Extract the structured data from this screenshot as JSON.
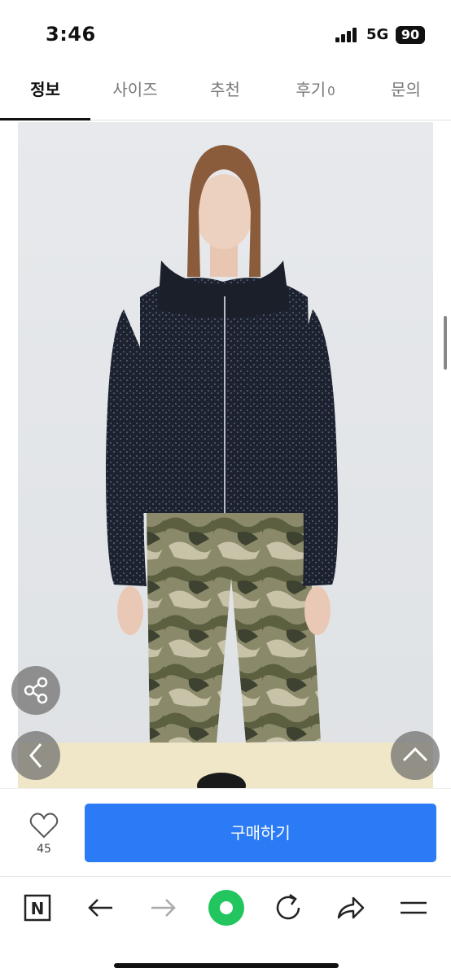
{
  "status_bar": {
    "time": "3:46",
    "network": "5G",
    "battery": "90"
  },
  "tabs": [
    {
      "label": "정보",
      "active": true
    },
    {
      "label": "사이즈",
      "active": false
    },
    {
      "label": "추천",
      "active": false
    },
    {
      "label": "후기",
      "count": "0",
      "active": false
    },
    {
      "label": "문의",
      "active": false
    }
  ],
  "product": {
    "image_icon": "product-photo-model-knit-zip-hoodie-camo-pants"
  },
  "overlay_buttons": {
    "share_icon": "share-icon",
    "prev_icon": "chevron-left-icon",
    "top_icon": "chevron-up-icon"
  },
  "purchase_bar": {
    "like_count": "45",
    "buy_label": "구매하기",
    "buy_color": "#2a7bf5"
  },
  "browser_toolbar": {
    "icons": [
      "naver-n-icon",
      "back-arrow-icon",
      "forward-arrow-icon",
      "green-dot-icon",
      "refresh-icon",
      "share-arrow-icon",
      "menu-icon"
    ],
    "accent": "#22c55e"
  }
}
